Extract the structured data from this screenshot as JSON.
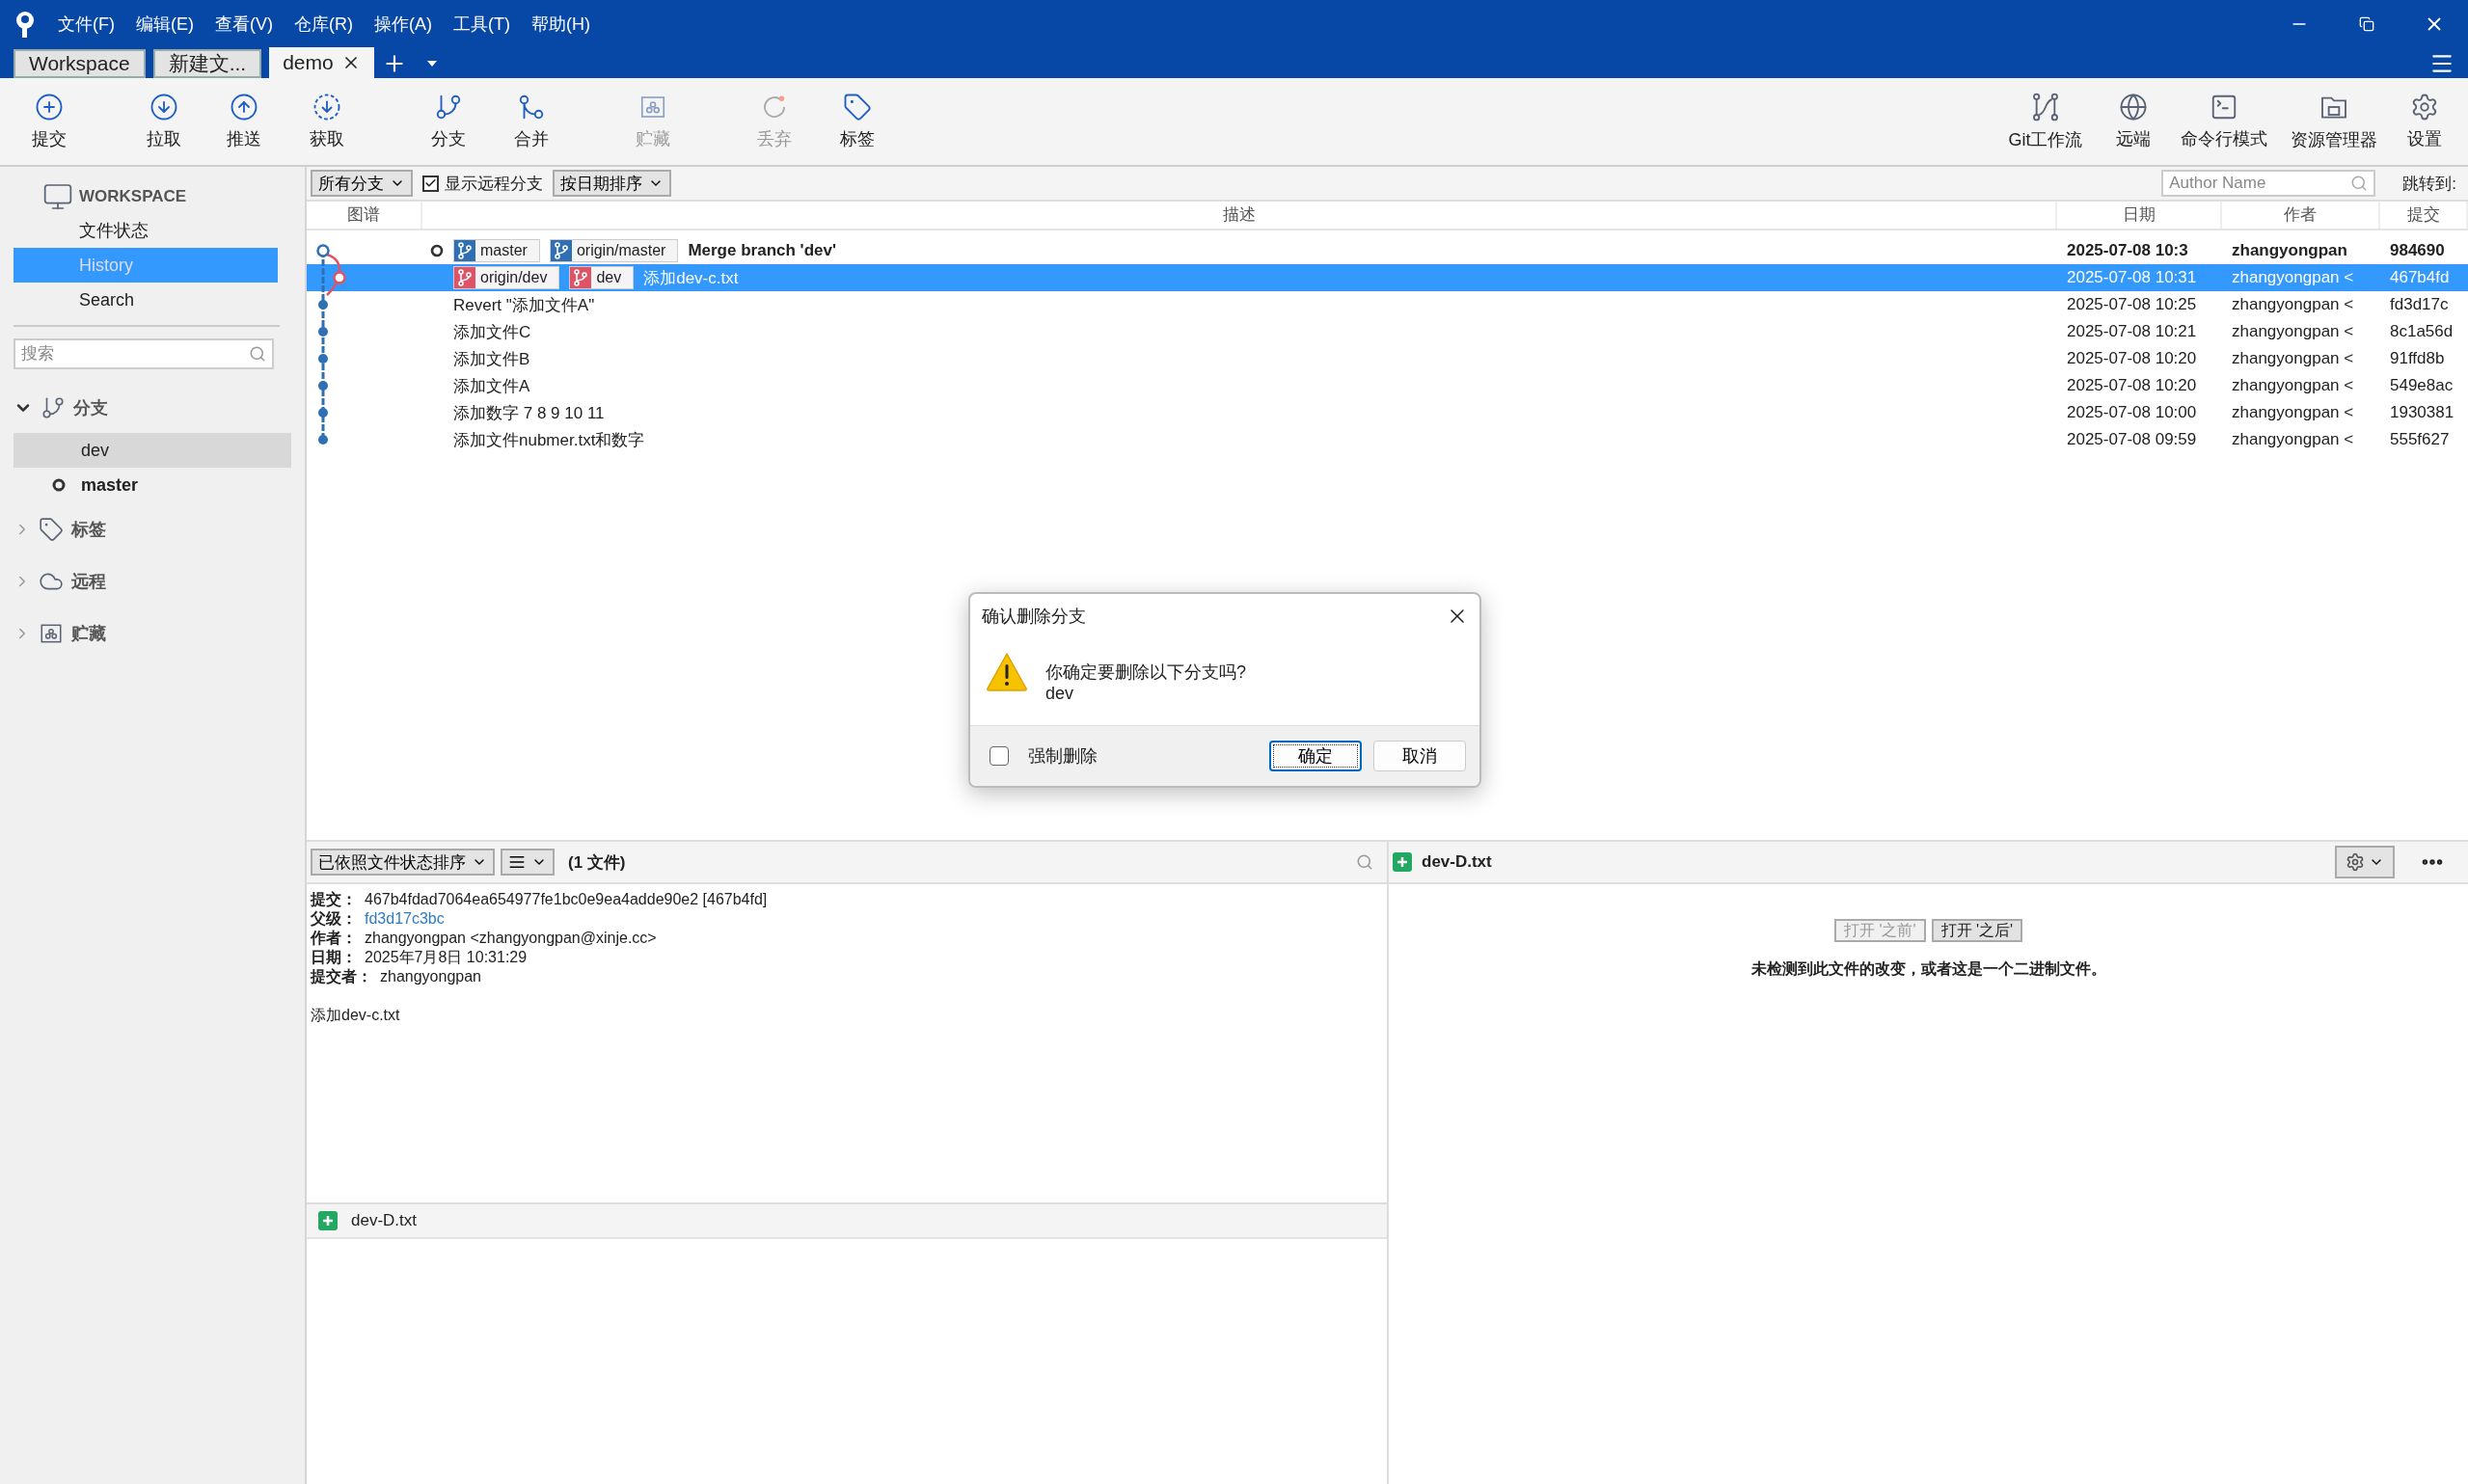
{
  "menu": [
    "文件(F)",
    "编辑(E)",
    "查看(V)",
    "仓库(R)",
    "操作(A)",
    "工具(T)",
    "帮助(H)"
  ],
  "tabs": [
    {
      "label": "Workspace",
      "selected": false,
      "closable": false
    },
    {
      "label": "新建文...",
      "selected": false,
      "closable": false
    },
    {
      "label": "demo",
      "selected": true,
      "closable": true
    }
  ],
  "toolbar": {
    "left": [
      {
        "kind": "commit",
        "label": "提交",
        "disabled": false
      },
      {
        "kind": "pull",
        "label": "拉取",
        "disabled": false
      },
      {
        "kind": "push",
        "label": "推送",
        "disabled": false
      },
      {
        "kind": "fetch",
        "label": "获取",
        "disabled": false
      },
      {
        "kind": "branch",
        "label": "分支",
        "disabled": false
      },
      {
        "kind": "merge",
        "label": "合并",
        "disabled": false
      },
      {
        "kind": "stash",
        "label": "贮藏",
        "disabled": true
      },
      {
        "kind": "discard",
        "label": "丢弃",
        "disabled": true
      },
      {
        "kind": "tag",
        "label": "标签",
        "disabled": false
      }
    ],
    "right": [
      {
        "kind": "flow",
        "label": "Git工作流",
        "disabled": false
      },
      {
        "kind": "remote",
        "label": "远端",
        "disabled": false
      },
      {
        "kind": "terminal",
        "label": "命令行模式",
        "disabled": false
      },
      {
        "kind": "explorer",
        "label": "资源管理器",
        "disabled": false
      },
      {
        "kind": "settings",
        "label": "设置",
        "disabled": false
      }
    ]
  },
  "sidebar": {
    "workspace": "WORKSPACE",
    "items": [
      {
        "label": "文件状态",
        "selected": false
      },
      {
        "label": "History",
        "selected": true
      },
      {
        "label": "Search",
        "selected": false
      }
    ],
    "search": {
      "placeholder": "搜索"
    },
    "sections": [
      {
        "kind": "branches",
        "label": "分支",
        "expanded": true,
        "children": [
          {
            "label": "dev",
            "selected": true,
            "current": false
          },
          {
            "label": "master",
            "selected": false,
            "current": true
          }
        ]
      },
      {
        "kind": "tags",
        "label": "标签",
        "expanded": false
      },
      {
        "kind": "remotes",
        "label": "远程",
        "expanded": false
      },
      {
        "kind": "stashes",
        "label": "贮藏",
        "expanded": false
      }
    ]
  },
  "filter": {
    "branches": "所有分支",
    "show_remote": {
      "label": "显示远程分支",
      "checked": true
    },
    "sort": "按日期排序",
    "author": {
      "placeholder": "Author Name"
    },
    "jump": "跳转到:"
  },
  "columns": [
    "图谱",
    "描述",
    "日期",
    "作者",
    "提交"
  ],
  "commits": [
    {
      "head": true,
      "selected": false,
      "refs": [
        {
          "name": "master",
          "color": "#2f6fb3"
        },
        {
          "name": "origin/master",
          "color": "#2f6fb3"
        }
      ],
      "message": "Merge branch 'dev'",
      "date": "2025-07-08 10:3",
      "author": "zhangyongpan",
      "hash": "984690"
    },
    {
      "head": false,
      "selected": true,
      "refs": [
        {
          "name": "origin/dev",
          "color": "#e05266"
        },
        {
          "name": "dev",
          "color": "#e05266"
        }
      ],
      "message": "添加dev-c.txt",
      "date": "2025-07-08 10:31",
      "author": "zhangyongpan <",
      "hash": "467b4fd"
    },
    {
      "head": false,
      "selected": false,
      "message": "Revert \"添加文件A\"",
      "date": "2025-07-08 10:25",
      "author": "zhangyongpan <",
      "hash": "fd3d17c"
    },
    {
      "head": false,
      "selected": false,
      "message": "添加文件C",
      "date": "2025-07-08 10:21",
      "author": "zhangyongpan <",
      "hash": "8c1a56d"
    },
    {
      "head": false,
      "selected": false,
      "message": "添加文件B",
      "date": "2025-07-08 10:20",
      "author": "zhangyongpan <",
      "hash": "91ffd8b"
    },
    {
      "head": false,
      "selected": false,
      "message": "添加文件A",
      "date": "2025-07-08 10:20",
      "author": "zhangyongpan <",
      "hash": "549e8ac"
    },
    {
      "head": false,
      "selected": false,
      "message": "添加数字 7 8 9 10 11",
      "date": "2025-07-08 10:00",
      "author": "zhangyongpan <",
      "hash": "1930381"
    },
    {
      "head": false,
      "selected": false,
      "message": "添加文件nubmer.txt和数字",
      "date": "2025-07-08 09:59",
      "author": "zhangyongpan <",
      "hash": "555f627"
    }
  ],
  "details": {
    "sort": "已依照文件状态排序",
    "count": "(1 文件)",
    "fields": [
      {
        "label": "提交：",
        "value": "467b4fdad7064ea654977fe1bc0e9ea4adde90e2 [467b4fd]",
        "link": false
      },
      {
        "label": "父级：",
        "value": "fd3d17c3bc",
        "link": true
      },
      {
        "label": "作者：",
        "value": "zhangyongpan <zhangyongpan@xinje.cc>",
        "link": false
      },
      {
        "label": "日期：",
        "value": "2025年7月8日 10:31:29",
        "link": false
      },
      {
        "label": "提交者：",
        "value": "zhangyongpan",
        "link": false
      }
    ],
    "message": "添加dev-c.txt",
    "files": [
      {
        "name": "dev-D.txt"
      }
    ]
  },
  "diff": {
    "file": "dev-D.txt",
    "buttons": [
      {
        "label": "打开 '之前'",
        "disabled": true
      },
      {
        "label": "打开 '之后'",
        "disabled": false
      }
    ],
    "notice": "未检测到此文件的改变，或者这是一个二进制文件。"
  },
  "dialog": {
    "title": "确认删除分支",
    "question": "你确定要删除以下分支吗?",
    "branch": "dev",
    "force": {
      "label": "强制删除",
      "checked": false
    },
    "buttons": [
      "确定",
      "取消"
    ]
  }
}
